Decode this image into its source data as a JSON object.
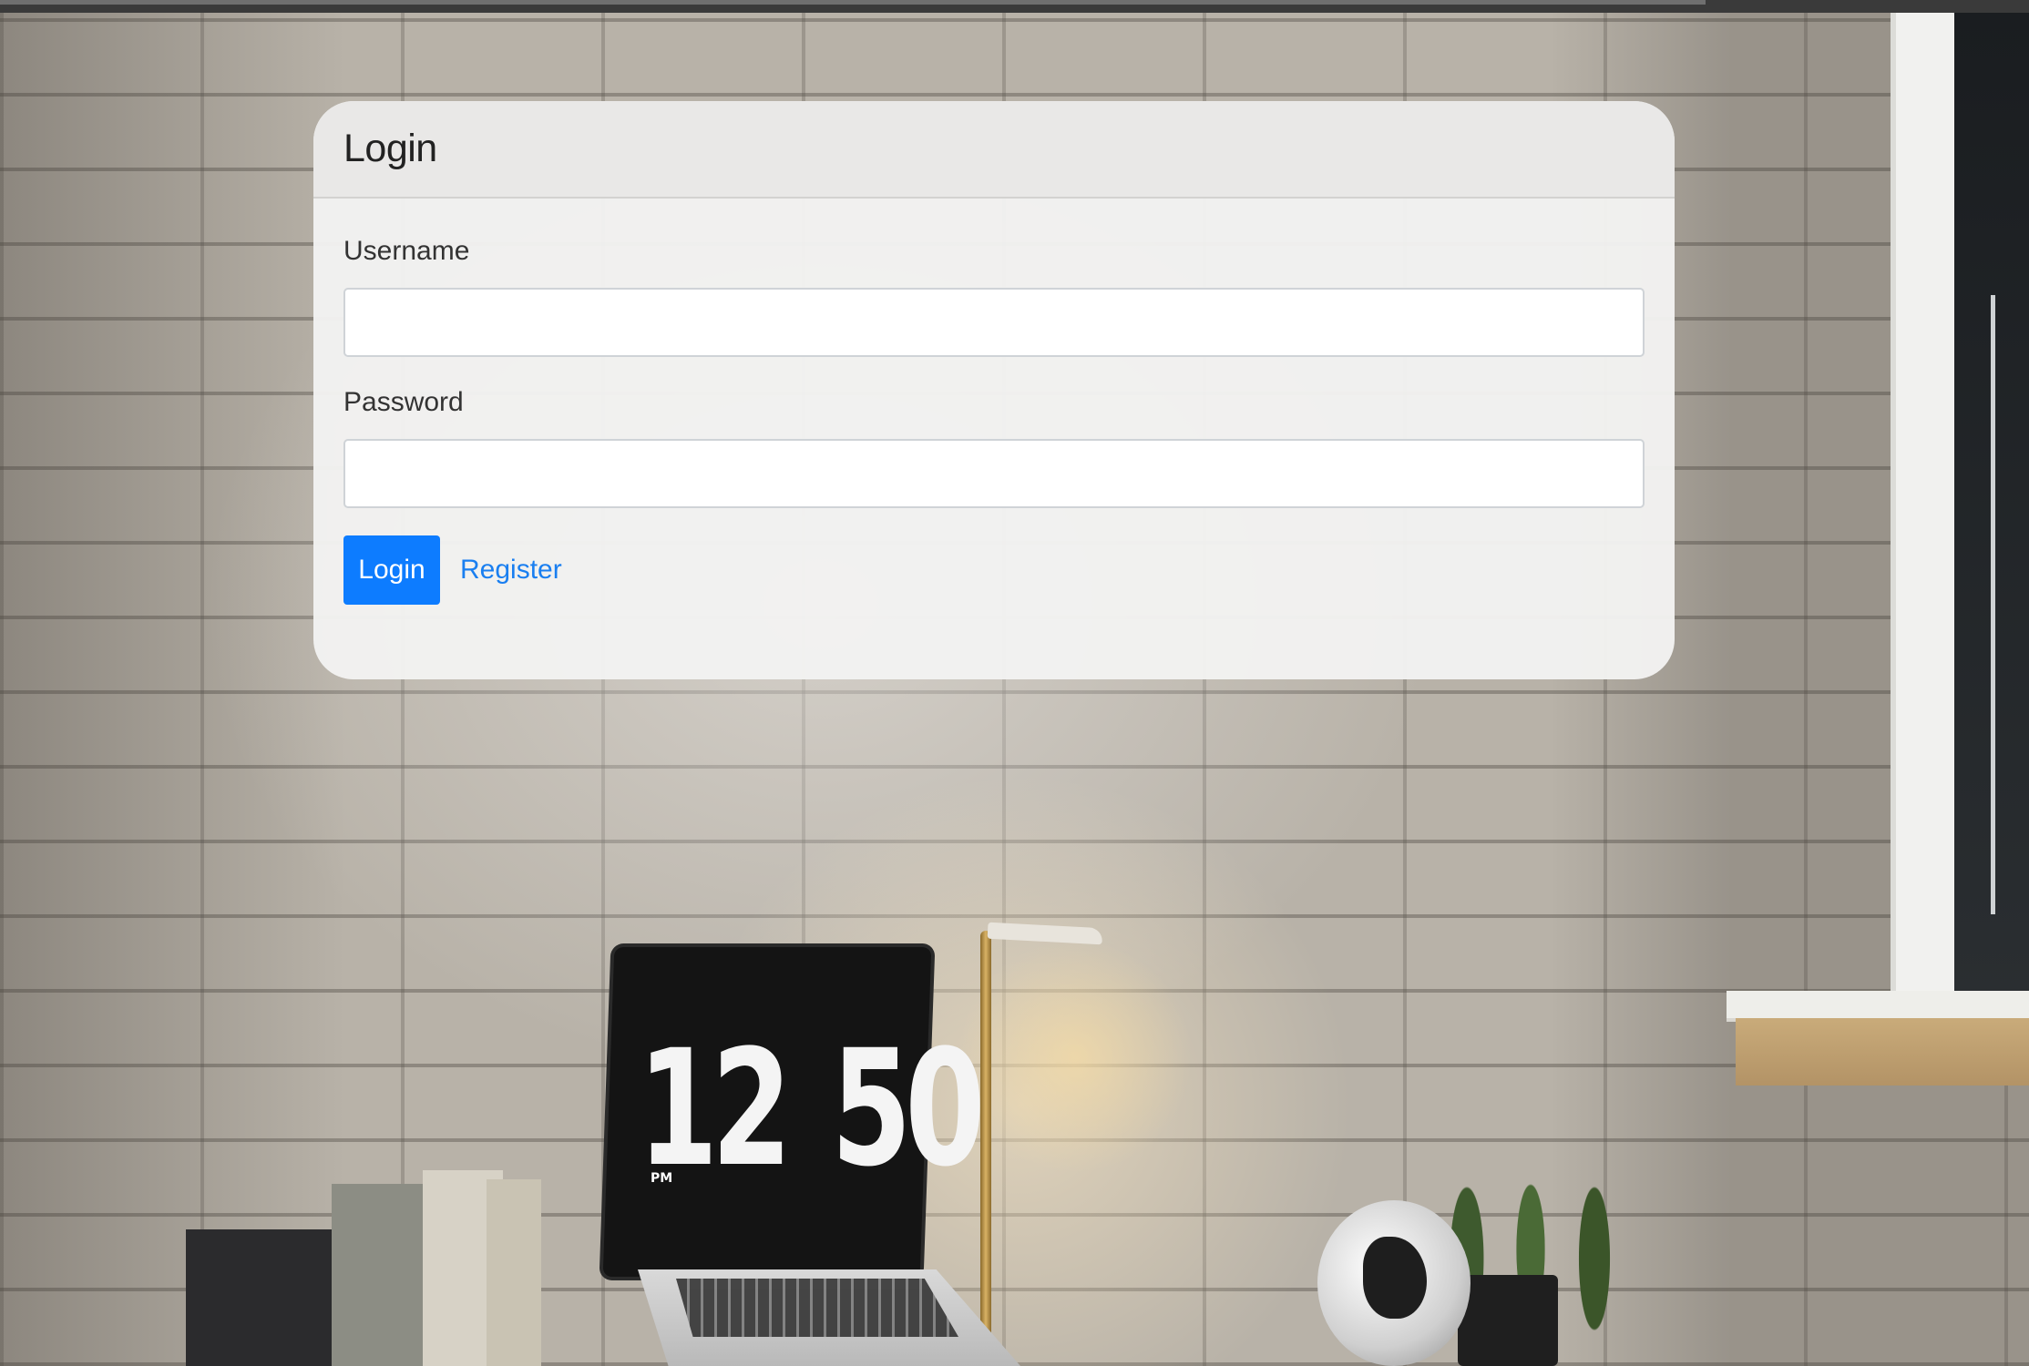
{
  "login_card": {
    "title": "Login",
    "username_label": "Username",
    "username_value": "",
    "password_label": "Password",
    "password_value": "",
    "login_button_label": "Login",
    "register_link_label": "Register"
  },
  "background": {
    "clock_hours": "12",
    "clock_minutes": "50",
    "clock_period": "PM"
  },
  "colors": {
    "primary_button": "#0d7cff",
    "link": "#1a7ff0",
    "card_background": "#f3f2f1"
  }
}
